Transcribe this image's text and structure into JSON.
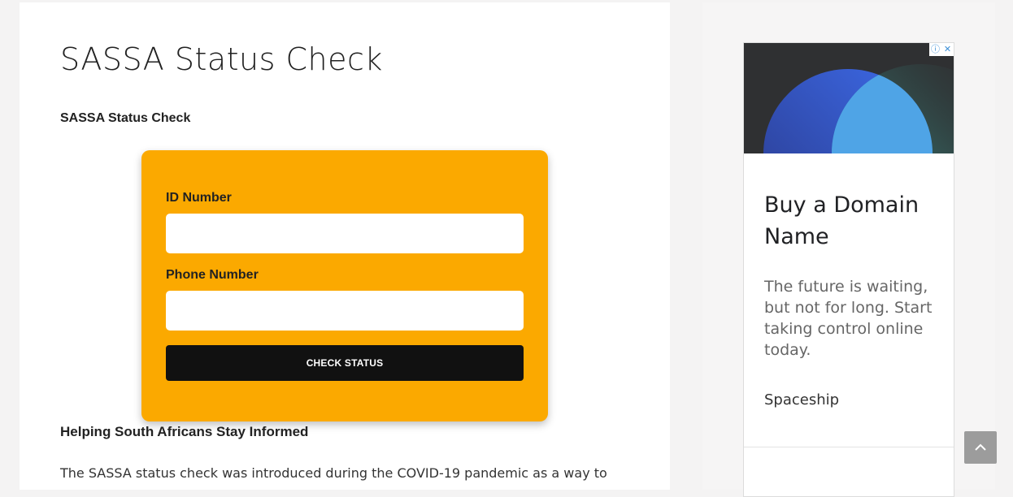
{
  "article": {
    "title": "SASSA Status Check",
    "subheading": "SASSA Status Check",
    "section_heading": "Helping South Africans Stay Informed",
    "paragraph": "The SASSA status check was introduced during the COVID-19 pandemic as a way to"
  },
  "form": {
    "id_label": "ID Number",
    "id_value": "",
    "phone_label": "Phone Number",
    "phone_value": "",
    "button_label": "CHECK STATUS",
    "background_color": "#fba900",
    "button_color": "#111111"
  },
  "ad": {
    "info_icon": "info-icon",
    "close_icon": "close-icon",
    "info_glyph": "ⓘ",
    "close_glyph": "✕",
    "title": "Buy a Domain Name",
    "description": "The future is waiting, but not for long. Start taking control online today.",
    "brand": "Spaceship"
  },
  "scroll_top": {
    "icon": "chevron-up-icon"
  }
}
